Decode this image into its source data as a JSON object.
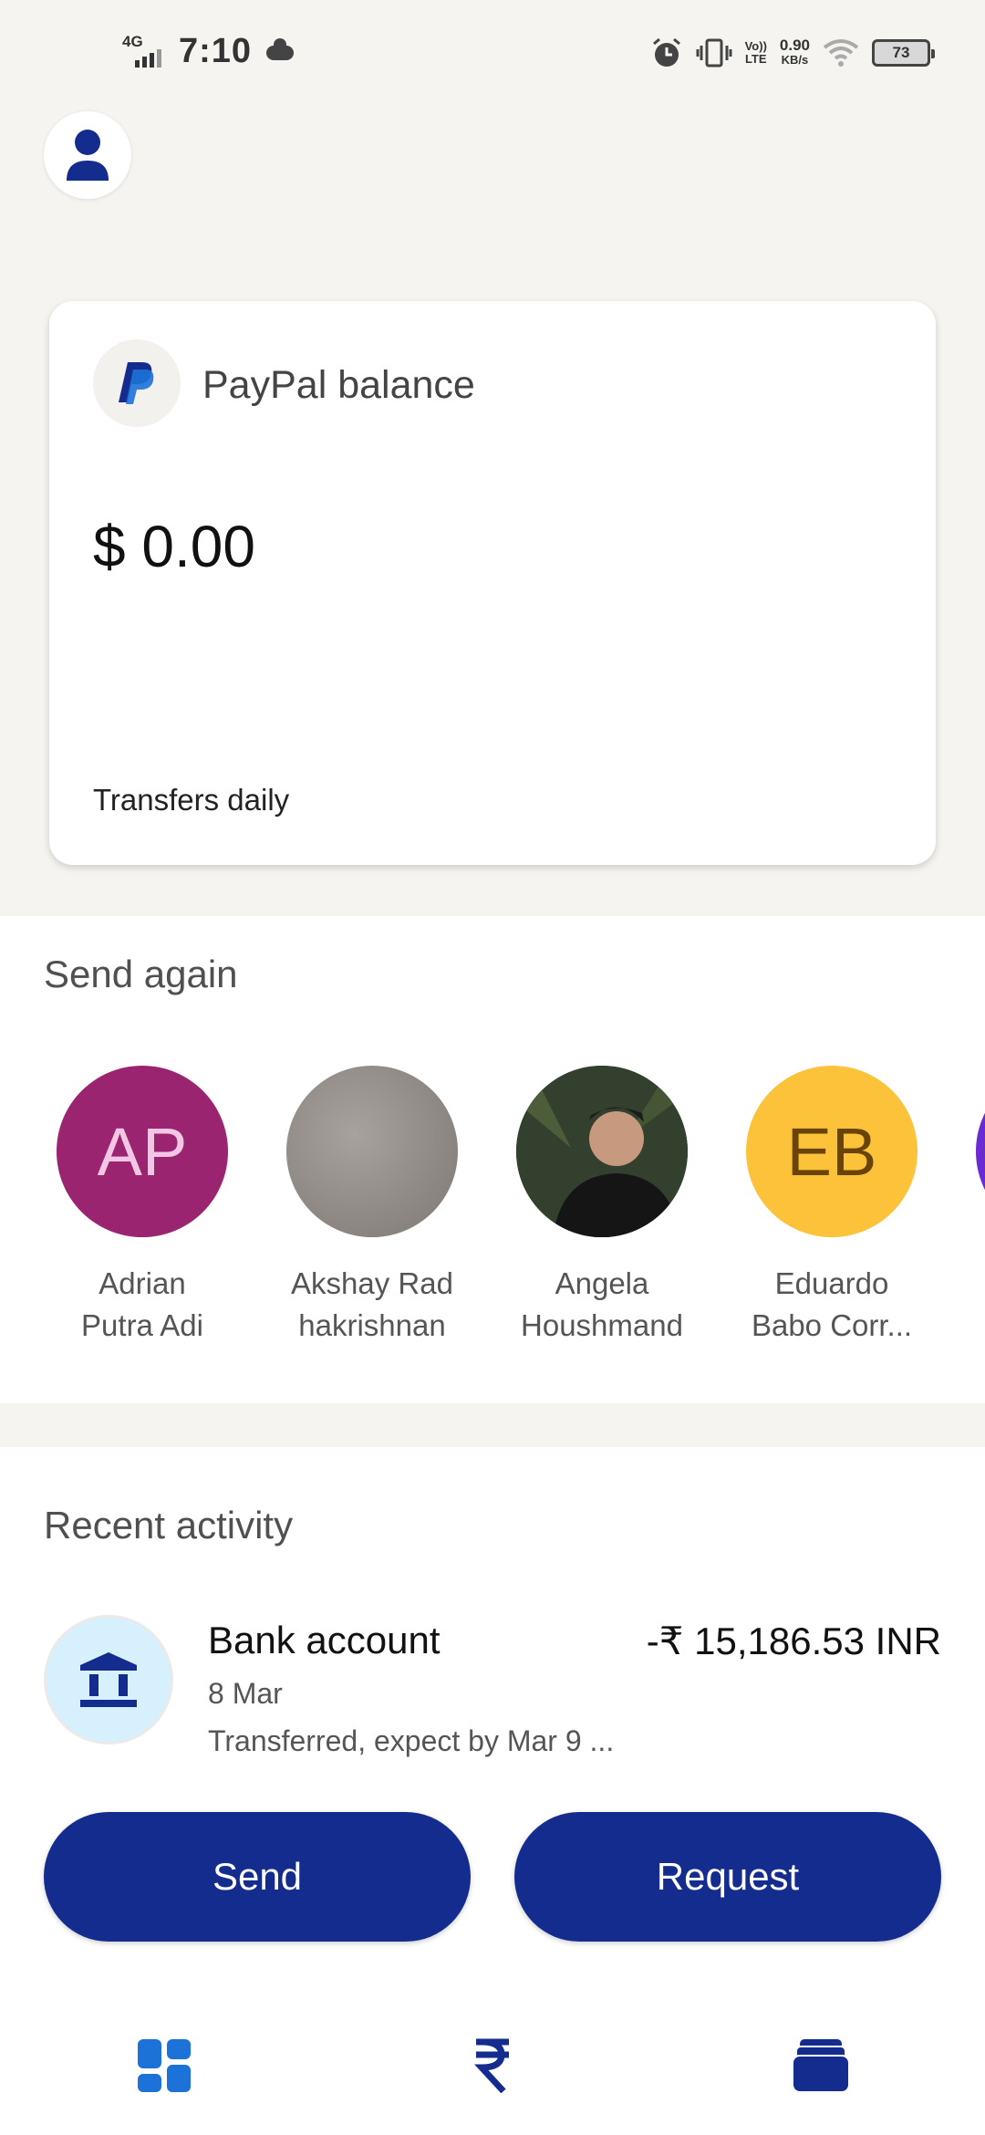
{
  "status_bar": {
    "network": "4G",
    "time": "7:10",
    "speed_value": "0.90",
    "speed_unit": "KB/s",
    "volte": "Vo))",
    "lte": "LTE",
    "battery": "73"
  },
  "balance_card": {
    "label": "PayPal balance",
    "amount": "$ 0.00",
    "transfer_note": "Transfers daily"
  },
  "send_again": {
    "title": "Send again",
    "contacts": [
      {
        "initials": "AP",
        "name_line1": "Adrian",
        "name_line2": "Putra Adi",
        "color": "#9b2470",
        "text_color": "#f4c6e6"
      },
      {
        "initials": "",
        "name_line1": "Akshay Rad",
        "name_line2": "hakrishnan",
        "color": "#8f8b87",
        "text_color": "#ffffff"
      },
      {
        "initials": "",
        "name_line1": "Angela",
        "name_line2": "Houshmand",
        "color": "#2b2f26",
        "text_color": "#ffffff"
      },
      {
        "initials": "EB",
        "name_line1": "Eduardo",
        "name_line2": "Babo Corr...",
        "color": "#fcc23a",
        "text_color": "#6a4306"
      }
    ]
  },
  "recent_activity": {
    "title": "Recent activity",
    "items": [
      {
        "title": "Bank account",
        "amount": "-₹ 15,186.53 INR",
        "date": "8 Mar",
        "description": "Transferred, expect by Mar 9 ..."
      }
    ]
  },
  "actions": {
    "send_label": "Send",
    "request_label": "Request"
  },
  "bottom_nav": {
    "items": [
      "dashboard-icon",
      "rupee-icon",
      "wallet-icon"
    ]
  },
  "colors": {
    "primary": "#142c8e",
    "background": "#f5f4f0",
    "bank_icon_bg": "#d6f1fd"
  }
}
